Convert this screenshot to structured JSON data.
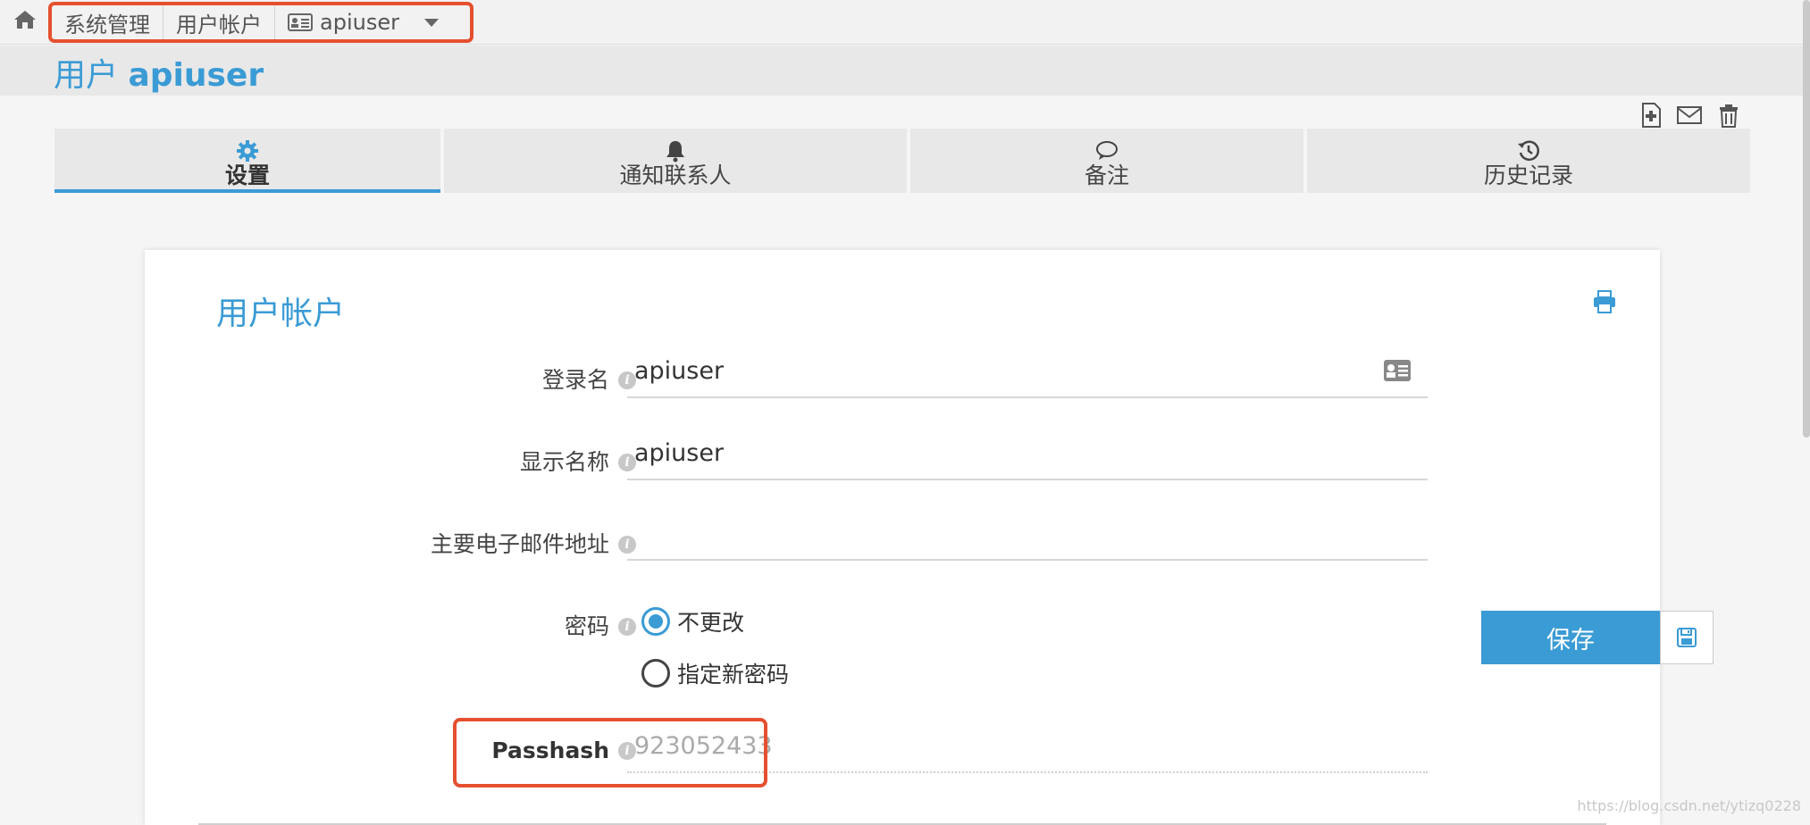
{
  "breadcrumb": {
    "items": [
      "系统管理",
      "用户帐户",
      "apiuser"
    ]
  },
  "page": {
    "title_prefix": "用户",
    "title_name": "apiuser"
  },
  "tabs": [
    {
      "label": "设置",
      "icon": "gear-icon",
      "active": true
    },
    {
      "label": "通知联系人",
      "icon": "bell-icon",
      "active": false
    },
    {
      "label": "备注",
      "icon": "comment-icon",
      "active": false
    },
    {
      "label": "历史记录",
      "icon": "history-icon",
      "active": false
    }
  ],
  "card": {
    "title": "用户帐户",
    "fields": {
      "login": {
        "label": "登录名",
        "value": "apiuser"
      },
      "display": {
        "label": "显示名称",
        "value": "apiuser"
      },
      "email": {
        "label": "主要电子邮件地址",
        "value": ""
      },
      "password": {
        "label": "密码",
        "options": [
          "不更改",
          "指定新密码"
        ],
        "selected": "不更改"
      },
      "passhash": {
        "label": "Passhash",
        "value": "923052433"
      }
    }
  },
  "actions": {
    "save_label": "保存"
  },
  "watermark": "https://blog.csdn.net/ytizq0228",
  "colors": {
    "accent": "#3a9bd5",
    "highlight": "#e5502f"
  }
}
